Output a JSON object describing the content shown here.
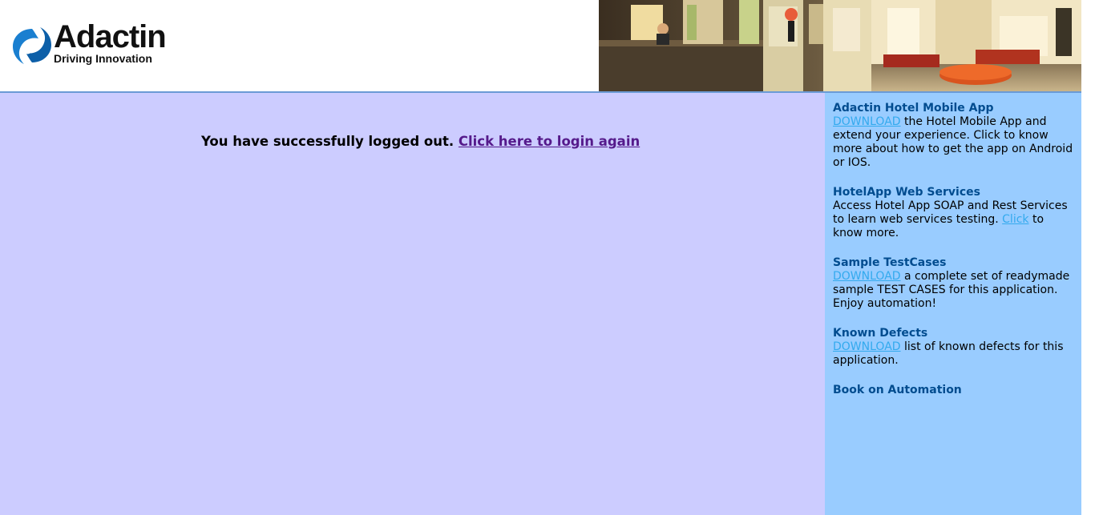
{
  "header": {
    "logo_name": "Adactin",
    "logo_tagline": "Driving Innovation",
    "banner_icon": "hotel-lobby-photo"
  },
  "main": {
    "message": "You have successfully logged out.",
    "login_link": "Click here to login again"
  },
  "sidebar": {
    "mobile_app": {
      "title": "Adactin Hotel Mobile App",
      "link": "DOWNLOAD",
      "text": " the Hotel Mobile App and extend your experience. Click to know more about how to get the app on Android or IOS."
    },
    "web_services": {
      "title": "HotelApp Web Services",
      "text_before": "Access Hotel App SOAP and Rest Services to learn web services testing. ",
      "link": "Click",
      "text_after": " to know more."
    },
    "test_cases": {
      "title": "Sample TestCases",
      "link": "DOWNLOAD",
      "text": " a complete set of readymade sample TEST CASES for this application. Enjoy automation!"
    },
    "known_defects": {
      "title": "Known Defects",
      "link": "DOWNLOAD",
      "text": " list of known defects for this application."
    },
    "book": {
      "title": "Book on Automation"
    }
  },
  "colors": {
    "main_bg": "#ccccff",
    "sidebar_bg": "#99ccff",
    "title_color": "#014c8f",
    "link_color": "#33aaee",
    "visited_link": "#551a8b"
  }
}
